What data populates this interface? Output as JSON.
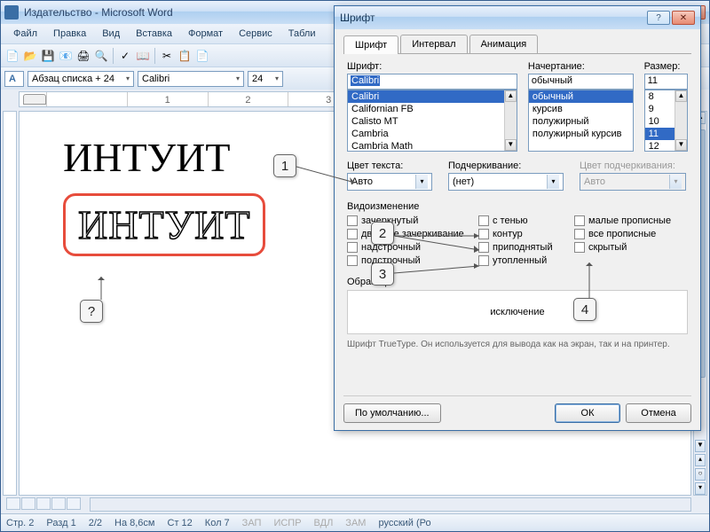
{
  "window": {
    "title": "Издательство - Microsoft Word"
  },
  "menu": {
    "file": "Файл",
    "edit": "Правка",
    "view": "Вид",
    "insert": "Вставка",
    "format": "Формат",
    "service": "Сервис",
    "table": "Табли"
  },
  "toolbar2": {
    "style": "Абзац списка + 24",
    "font": "Calibri",
    "size": "24"
  },
  "document": {
    "text1": "ИНТУИТ",
    "text2": "ИНТУИТ"
  },
  "callouts": {
    "q": "?",
    "c1": "1",
    "c2": "2",
    "c3": "3",
    "c4": "4"
  },
  "statusbar": {
    "page": "Стр. 2",
    "section": "Разд 1",
    "pages": "2/2",
    "at": "На 8,6см",
    "line": "Ст 12",
    "col": "Кол 7",
    "rec": "ЗАП",
    "fix": "ИСПР",
    "ext": "ВДЛ",
    "ovr": "ЗАМ",
    "lang": "русский (Ро"
  },
  "dialog": {
    "title": "Шрифт",
    "tabs": {
      "font": "Шрифт",
      "spacing": "Интервал",
      "animation": "Анимация"
    },
    "labels": {
      "font": "Шрифт:",
      "style": "Начертание:",
      "size": "Размер:",
      "color": "Цвет текста:",
      "underline": "Подчеркивание:",
      "ucolor": "Цвет подчеркивания:",
      "effects": "Видоизменение",
      "preview": "Образец"
    },
    "values": {
      "font": "Calibri",
      "style": "обычный",
      "size": "11",
      "color": "Авто",
      "underline": "(нет)",
      "ucolor": "Авто"
    },
    "font_list": [
      "Calibri",
      "Californian FB",
      "Calisto MT",
      "Cambria",
      "Cambria Math"
    ],
    "style_list": [
      "обычный",
      "курсив",
      "полужирный",
      "полужирный курсив"
    ],
    "size_list": [
      "8",
      "9",
      "10",
      "11",
      "12"
    ],
    "effects": {
      "strike": "зачеркнутый",
      "dstrike": "двойное зачеркивание",
      "super": "надстрочный",
      "sub": "подстрочный",
      "shadow": "с тенью",
      "outline": "контур",
      "emboss": "приподнятый",
      "engrave": "утопленный",
      "smallcaps": "малые прописные",
      "allcaps": "все прописные",
      "hidden": "скрытый"
    },
    "preview_text": "исключение",
    "hint": "Шрифт TrueType. Он используется для вывода как на экран, так и на принтер.",
    "buttons": {
      "default": "По умолчанию...",
      "ok": "ОК",
      "cancel": "Отмена"
    }
  }
}
